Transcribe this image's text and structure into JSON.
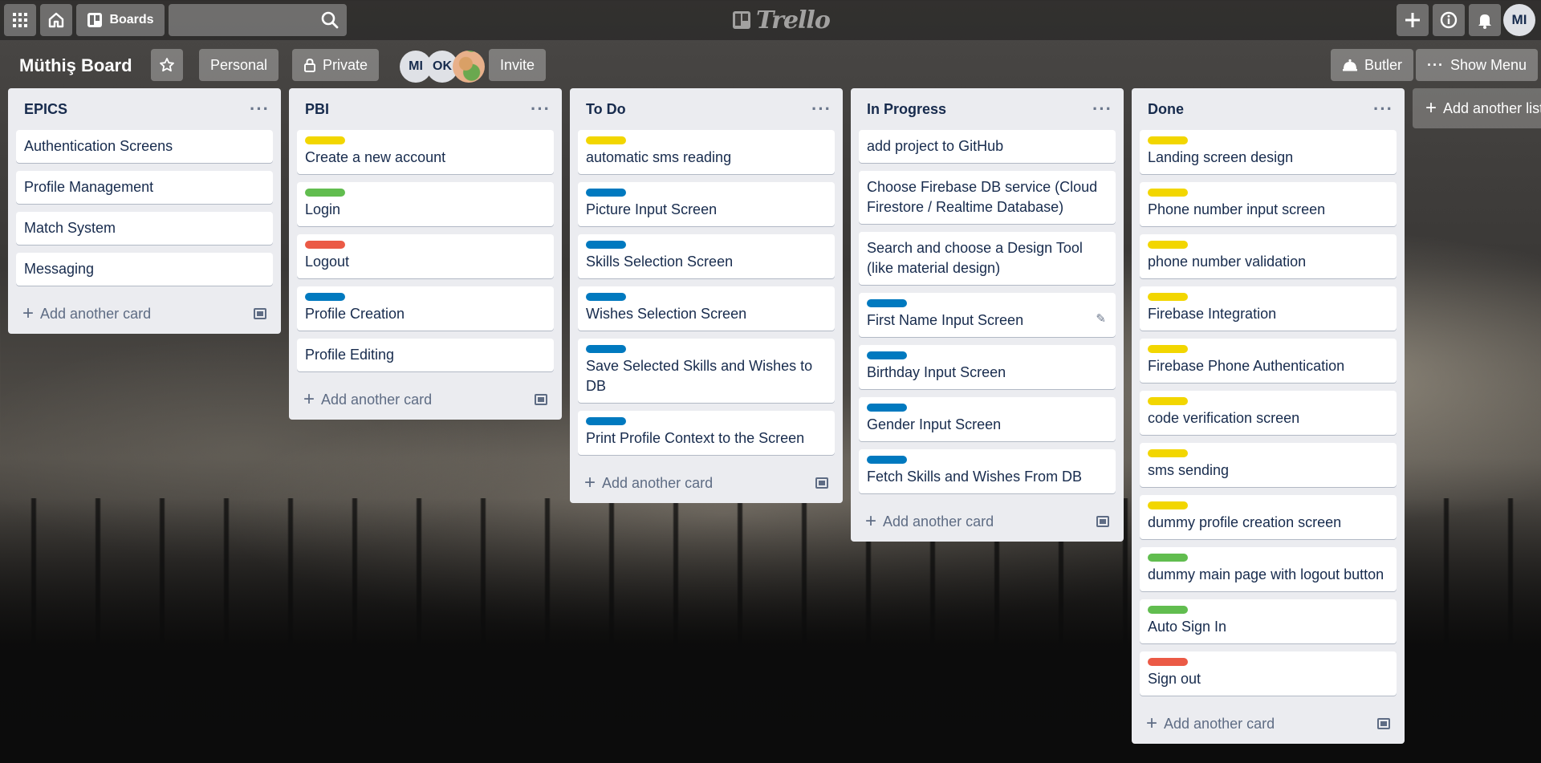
{
  "app": {
    "logo_text": "Trello"
  },
  "header": {
    "boards_label": "Boards",
    "search_value": "",
    "avatar_initials": "MI"
  },
  "board": {
    "title": "Müthiş Board",
    "visibility_team": "Personal",
    "visibility_privacy": "Private",
    "members": [
      "MI",
      "OK"
    ],
    "invite_label": "Invite",
    "butler_label": "Butler",
    "menu_label": "Show Menu"
  },
  "add_list_label": "Add another list",
  "colors": {
    "yellow": "#f2d600",
    "green": "#61bd4f",
    "red": "#eb5a46",
    "blue": "#0079bf"
  },
  "lists": [
    {
      "title": "EPICS",
      "add_label": "Add another card",
      "cards": [
        {
          "title": "Authentication Screens",
          "label": null
        },
        {
          "title": "Profile Management",
          "label": null
        },
        {
          "title": "Match System",
          "label": null
        },
        {
          "title": "Messaging",
          "label": null
        }
      ]
    },
    {
      "title": "PBI",
      "add_label": "Add another card",
      "cards": [
        {
          "title": "Create a new account",
          "label": "yellow"
        },
        {
          "title": "Login",
          "label": "green"
        },
        {
          "title": "Logout",
          "label": "red"
        },
        {
          "title": "Profile Creation",
          "label": "blue"
        },
        {
          "title": "Profile Editing",
          "label": null
        }
      ]
    },
    {
      "title": "To Do",
      "add_label": "Add another card",
      "cards": [
        {
          "title": "automatic sms reading",
          "label": "yellow"
        },
        {
          "title": "Picture Input Screen",
          "label": "blue"
        },
        {
          "title": "Skills Selection Screen",
          "label": "blue"
        },
        {
          "title": "Wishes Selection Screen",
          "label": "blue"
        },
        {
          "title": "Save Selected Skills and Wishes to DB",
          "label": "blue"
        },
        {
          "title": "Print Profile Context to the Screen",
          "label": "blue"
        }
      ]
    },
    {
      "title": "In Progress",
      "add_label": "Add another card",
      "cards": [
        {
          "title": "add project to GitHub",
          "label": null
        },
        {
          "title": "Choose Firebase DB service (Cloud Firestore / Realtime Database)",
          "label": null
        },
        {
          "title": "Search and choose a Design Tool (like material design)",
          "label": null
        },
        {
          "title": "First Name Input Screen",
          "label": "blue",
          "hover": true
        },
        {
          "title": "Birthday Input Screen",
          "label": "blue"
        },
        {
          "title": "Gender Input Screen",
          "label": "blue"
        },
        {
          "title": "Fetch Skills and Wishes From DB",
          "label": "blue"
        }
      ]
    },
    {
      "title": "Done",
      "add_label": "Add another card",
      "cards": [
        {
          "title": "Landing screen design",
          "label": "yellow"
        },
        {
          "title": "Phone number input screen",
          "label": "yellow"
        },
        {
          "title": "phone number validation",
          "label": "yellow"
        },
        {
          "title": "Firebase Integration",
          "label": "yellow"
        },
        {
          "title": "Firebase Phone Authentication",
          "label": "yellow"
        },
        {
          "title": "code verification screen",
          "label": "yellow"
        },
        {
          "title": "sms sending",
          "label": "yellow"
        },
        {
          "title": "dummy profile creation screen",
          "label": "yellow"
        },
        {
          "title": "dummy main page with logout button",
          "label": "green"
        },
        {
          "title": "Auto Sign In",
          "label": "green"
        },
        {
          "title": "Sign out",
          "label": "red"
        }
      ]
    }
  ]
}
